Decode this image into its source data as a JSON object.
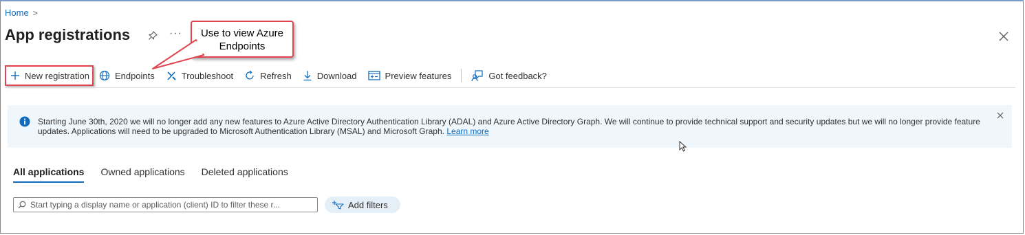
{
  "breadcrumb": {
    "home": "Home",
    "separator": ">"
  },
  "page": {
    "title": "App registrations",
    "more": "···"
  },
  "callout": {
    "text": "Use to view Azure Endpoints"
  },
  "toolbar": {
    "new_registration": "New registration",
    "endpoints": "Endpoints",
    "troubleshoot": "Troubleshoot",
    "refresh": "Refresh",
    "download": "Download",
    "preview_features": "Preview features",
    "got_feedback": "Got feedback?"
  },
  "banner": {
    "message": "Starting June 30th, 2020 we will no longer add any new features to Azure Active Directory Authentication Library (ADAL) and Azure Active Directory Graph. We will continue to provide technical support and security updates but we will no longer provide feature updates. Applications will need to be upgraded to Microsoft Authentication Library (MSAL) and Microsoft Graph.",
    "link": "Learn more"
  },
  "tabs": [
    {
      "label": "All applications",
      "active": true
    },
    {
      "label": "Owned applications",
      "active": false
    },
    {
      "label": "Deleted applications",
      "active": false
    }
  ],
  "search": {
    "placeholder": "Start typing a display name or application (client) ID to filter these r..."
  },
  "filters": {
    "add_label": "Add filters"
  },
  "colors": {
    "accent": "#0f6cbd",
    "highlight_border": "#e0454f",
    "banner_bg": "#eff6fc"
  },
  "icons": [
    "chevron-right-icon",
    "pin-icon",
    "close-icon",
    "plus-icon",
    "globe-icon",
    "wrench-icon",
    "refresh-icon",
    "download-icon",
    "preview-icon",
    "feedback-icon",
    "info-icon",
    "search-icon",
    "add-filter-icon",
    "cursor-icon"
  ]
}
